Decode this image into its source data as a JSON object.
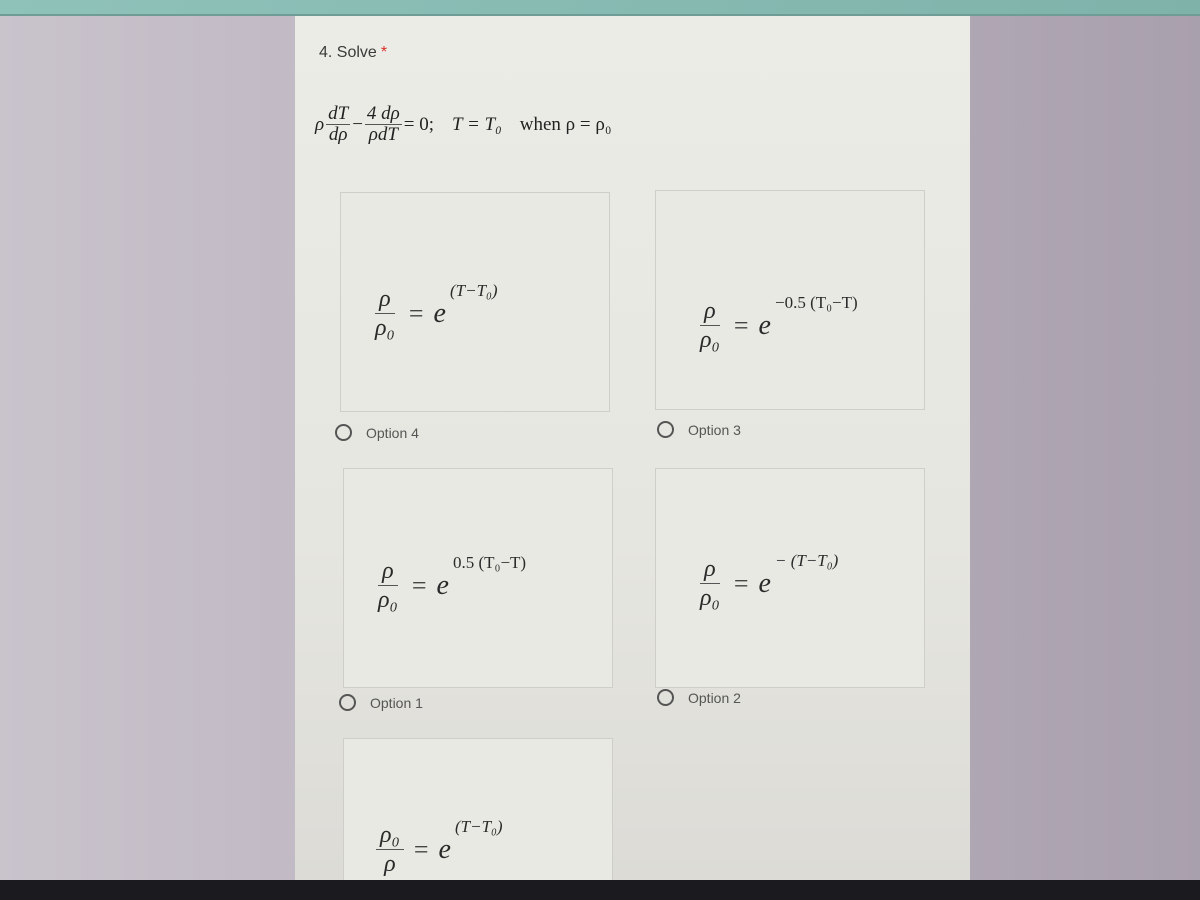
{
  "question": {
    "number_title": "4. Solve",
    "required_mark": "*",
    "equation": {
      "lhs_coef": "ρ",
      "frac1_num": "dT",
      "frac1_den": "dρ",
      "minus": "−",
      "frac2_num": "4 dρ",
      "frac2_den": "ρdT",
      "equals_zero": "= 0;",
      "condition1": "T = T₀",
      "condition2": "when ρ = ρ₀"
    }
  },
  "options": [
    {
      "label": "Option 4",
      "num": "ρ",
      "den": "ρ₀",
      "equals": "=",
      "base": "e",
      "exponent": "(T−T₀)"
    },
    {
      "label": "Option 3",
      "num": "ρ",
      "den": "ρ₀",
      "equals": "=",
      "base": "e",
      "exponent": "−0.5 (T₀−T)"
    },
    {
      "label": "Option 1",
      "num": "ρ",
      "den": "ρ₀",
      "equals": "=",
      "base": "e",
      "exponent": "0.5 (T₀−T)"
    },
    {
      "label": "Option 2",
      "num": "ρ",
      "den": "ρ₀",
      "equals": "=",
      "base": "e",
      "exponent": "− (T−T₀)"
    },
    {
      "num": "ρ₀",
      "den": "ρ",
      "equals": "=",
      "base": "e",
      "exponent": "(T−T₀)"
    }
  ],
  "colors": {
    "required": "#d93025",
    "top_bar": "#8fc2b9",
    "card_bg": "#ecece7"
  }
}
